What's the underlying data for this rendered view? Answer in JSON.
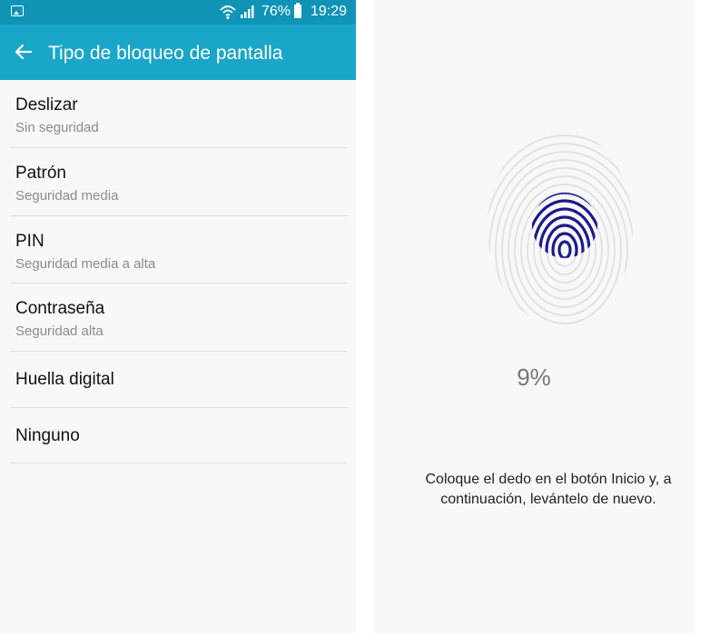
{
  "status_bar": {
    "battery": "76%",
    "time": "19:29"
  },
  "header": {
    "title": "Tipo de bloqueo de pantalla"
  },
  "options": [
    {
      "title": "Deslizar",
      "subtitle": "Sin seguridad"
    },
    {
      "title": "Patrón",
      "subtitle": "Seguridad media"
    },
    {
      "title": "PIN",
      "subtitle": "Seguridad media a alta"
    },
    {
      "title": "Contraseña",
      "subtitle": "Seguridad alta"
    },
    {
      "title": "Huella digital"
    },
    {
      "title": "Ninguno"
    }
  ],
  "fingerprint": {
    "progress_text": "9%",
    "progress": 0.09,
    "instruction": "Coloque el dedo en el botón Inicio y, a continuación, levántelo de nuevo."
  },
  "colors": {
    "status_bar": "#0f94b6",
    "app_bar": "#1aa6c8",
    "fingerprint_active": "#1a1a8c",
    "fingerprint_inactive": "#e2e2e2"
  }
}
